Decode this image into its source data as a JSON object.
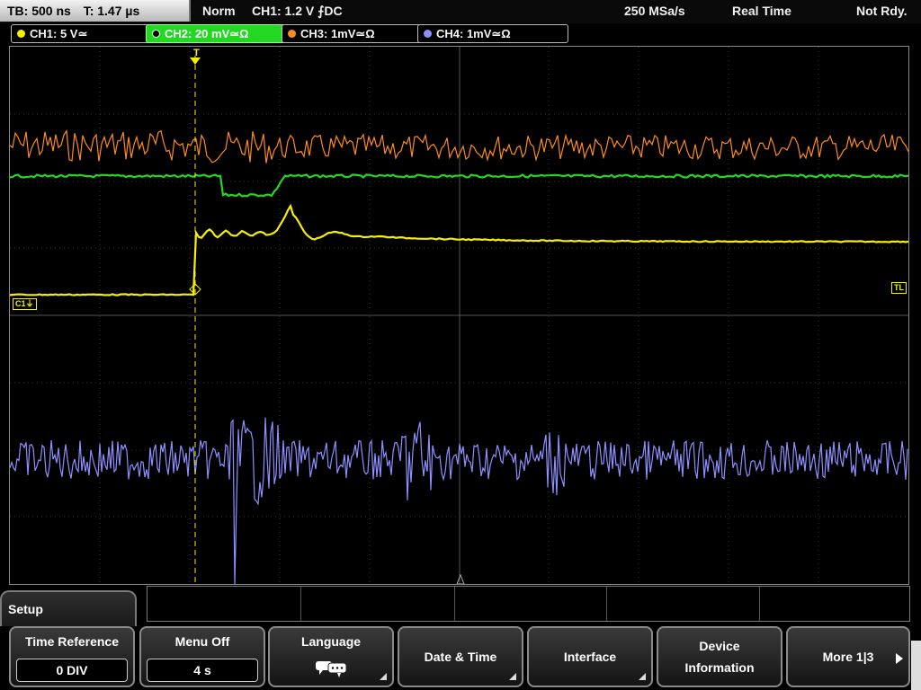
{
  "status": {
    "timebase": "TB: 500 ns",
    "trigger_time": "T: 1.47 µs",
    "mode": "Norm",
    "trigger": "CH1: 1.2 V ⨍DC",
    "sample_rate": "250 MSa/s",
    "acq_mode": "Real Time",
    "state": "Not Rdy."
  },
  "channels": [
    {
      "label": "CH1: 5 V≃",
      "color": "#f5f000"
    },
    {
      "label": "CH2: 20 mV≃Ω",
      "color": "#22d822"
    },
    {
      "label": "CH3: 1mV≃Ω",
      "color": "#ff8c1a"
    },
    {
      "label": "CH4: 1mV≃Ω",
      "color": "#8f8fff"
    }
  ],
  "screen": {
    "trigger_marker": "T",
    "trigger_level_label": "TL",
    "ch1_ground_label": "C1⏚"
  },
  "menu": {
    "section": "Setup",
    "time_reference": {
      "title": "Time Reference",
      "value": "0 DIV"
    },
    "menu_off": {
      "title": "Menu Off",
      "value": "4 s"
    },
    "language": {
      "title": "Language",
      "icon": "speech-bubbles-icon"
    },
    "date_time": "Date & Time",
    "interface": "Interface",
    "device_info": [
      "Device",
      "Information"
    ],
    "more": "More 1|3"
  }
}
